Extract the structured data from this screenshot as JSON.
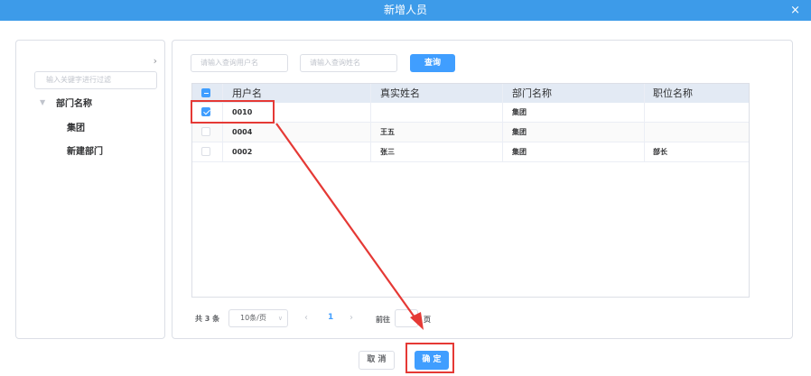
{
  "dialog": {
    "title": "新增人员",
    "close_glyph": "×"
  },
  "left": {
    "collapse_glyph": "›",
    "filter_placeholder": "输入关键字进行过滤",
    "tree": {
      "root": "部门名称",
      "children": [
        "集团",
        "新建部门"
      ]
    }
  },
  "search": {
    "username_placeholder": "请输入查询用户名",
    "realname_placeholder": "请输入查询姓名",
    "query_label": "查询"
  },
  "table": {
    "columns": [
      "用户名",
      "真实姓名",
      "部门名称",
      "职位名称"
    ],
    "rows": [
      {
        "username": "0010",
        "realname": "",
        "dept": "集团",
        "position": "",
        "checked": true
      },
      {
        "username": "0004",
        "realname": "王五",
        "dept": "集团",
        "position": "",
        "checked": false
      },
      {
        "username": "0002",
        "realname": "张三",
        "dept": "集团",
        "position": "部长",
        "checked": false
      }
    ]
  },
  "pagination": {
    "total_text": "共 3 条",
    "page_size": "10条/页",
    "prev_glyph": "‹",
    "next_glyph": "›",
    "current_page": "1",
    "goto_label": "前往",
    "page_suffix": "页"
  },
  "footer": {
    "cancel_label": "取 消",
    "ok_label": "确 定"
  },
  "colors": {
    "primary": "#409eff",
    "title_bar": "#3d9be9",
    "highlight": "#e53935"
  }
}
